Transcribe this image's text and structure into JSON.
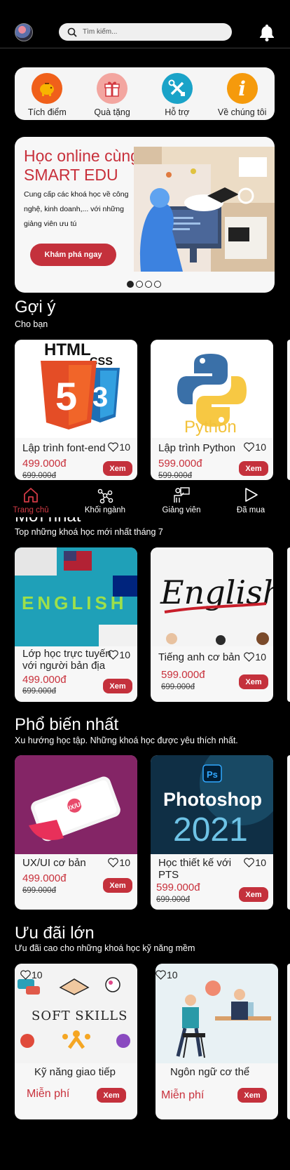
{
  "header": {
    "search_placeholder": "Tìm kiếm..."
  },
  "quick_menu": [
    {
      "label": "Tích điểm",
      "icon": "piggy-bank-icon",
      "color": "#f0601a"
    },
    {
      "label": "Quà tặng",
      "icon": "gift-icon",
      "color": "#f3a6a0"
    },
    {
      "label": "Hỗ trợ",
      "icon": "tools-icon",
      "color": "#1aa3c8"
    },
    {
      "label": "Về chúng tôi",
      "icon": "info-icon",
      "color": "#f59a0c"
    }
  ],
  "banner": {
    "title": "Học online cùng SMART EDU",
    "description": "Cung cấp các khoá học về công nghệ, kinh doanh,... với những giảng viên ưu tú",
    "button": "Khám phá ngay",
    "slides": 4,
    "active_slide": 1
  },
  "sections": {
    "suggest": {
      "title": "Gợi ý",
      "subtitle": "Cho bạn",
      "cards": [
        {
          "name": "Lập trình font-end",
          "likes": "10",
          "price": "499.000đ",
          "old_price": "699.000đ",
          "button": "Xem",
          "thumb": "html-css-logo"
        },
        {
          "name": "Lập trình Python",
          "likes": "10",
          "price": "599.000đ",
          "old_price": "599.000đ",
          "button": "Xem",
          "thumb": "python-logo",
          "thumb_text": "Python"
        }
      ]
    },
    "newest": {
      "title": "Mới nhất",
      "subtitle": "Top những khoá học mới nhất tháng 7",
      "cards": [
        {
          "name": "Lớp học trực tuyến với người bản địa",
          "likes": "10",
          "price": "499.000đ",
          "old_price": "699.000đ",
          "button": "Xem",
          "thumb": "english-blocks",
          "thumb_text": "ENGLISH"
        },
        {
          "name": "Tiếng anh cơ bản",
          "likes": "10",
          "price": "599.000đ",
          "old_price": "699.000đ",
          "button": "Xem",
          "thumb": "english-handwriting",
          "thumb_text": "English"
        }
      ]
    },
    "popular": {
      "title": "Phổ biến nhất",
      "subtitle": "Xu hướng học tập. Những khoá học được yêu thích nhất.",
      "cards": [
        {
          "name": "UX/UI cơ bản",
          "likes": "10",
          "price": "499.000đ",
          "old_price": "699.000đ",
          "button": "Xem",
          "thumb": "ux-ui-phone",
          "thumb_text": "UX/UI"
        },
        {
          "name": "Học thiết kế với PTS",
          "likes": "10",
          "price": "599.000đ",
          "old_price": "699.000đ",
          "button": "Xem",
          "thumb": "photoshop-2021",
          "thumb_text": "Photoshop",
          "thumb_text2": "2021"
        }
      ]
    },
    "deals": {
      "title": "Ưu đãi lớn",
      "subtitle": "Ưu đãi cao cho những khoá học kỹ năng mềm",
      "cards": [
        {
          "name": "Kỹ năng giao tiếp",
          "likes": "10",
          "price": "Miễn phí",
          "button": "Xem",
          "thumb": "soft-skills",
          "thumb_text": "SOFT SKILLS"
        },
        {
          "name": "Ngôn ngữ cơ thể",
          "likes": "10",
          "price": "Miễn phí",
          "button": "Xem",
          "thumb": "body-language"
        }
      ]
    }
  },
  "bottom_nav": [
    {
      "label": "Trang chủ",
      "icon": "home-icon",
      "active": true
    },
    {
      "label": "Khối ngành",
      "icon": "network-icon",
      "active": false
    },
    {
      "label": "Giảng viên",
      "icon": "teacher-icon",
      "active": false
    },
    {
      "label": "Đã mua",
      "icon": "play-icon",
      "active": false
    }
  ],
  "colors": {
    "accent": "#c4313c",
    "card_bg": "#f7f7f7",
    "background": "#000000"
  }
}
